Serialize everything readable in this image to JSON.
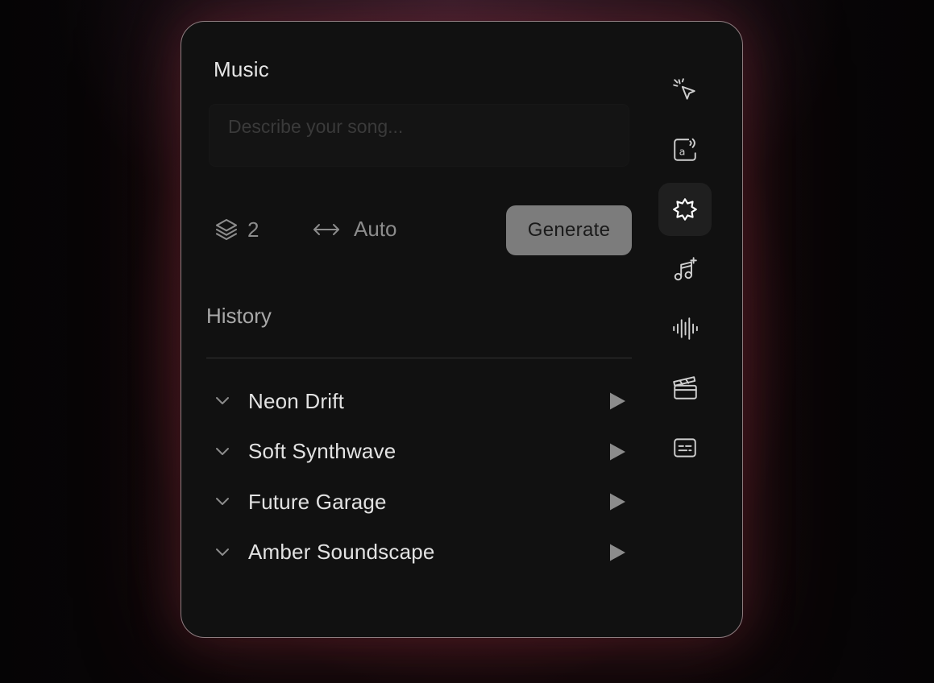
{
  "panel": {
    "title": "Music",
    "prompt_placeholder": "Describe your song...",
    "prompt_value": ""
  },
  "controls": {
    "variations_icon": "layers-icon",
    "variations_count": "2",
    "duration_icon": "arrows-horizontal-icon",
    "duration_label": "Auto",
    "generate_label": "Generate"
  },
  "history": {
    "title": "History",
    "items": [
      {
        "name": "Neon Drift"
      },
      {
        "name": "Soft Synthwave"
      },
      {
        "name": "Future Garage"
      },
      {
        "name": "Amber Soundscape"
      }
    ]
  },
  "rail": {
    "items": [
      {
        "icon": "cursor-sparkle-icon",
        "active": false
      },
      {
        "icon": "text-speech-icon",
        "active": false
      },
      {
        "icon": "starburst-icon",
        "active": true
      },
      {
        "icon": "music-note-sparkle-icon",
        "active": false
      },
      {
        "icon": "waveform-icon",
        "active": false
      },
      {
        "icon": "clapperboard-icon",
        "active": false
      },
      {
        "icon": "subtitles-icon",
        "active": false
      }
    ]
  },
  "colors": {
    "panel_bg": "#111111",
    "panel_border": "#8e7d80",
    "generate_bg": "#7c7c7c",
    "text_primary": "#e2e2e2",
    "text_muted": "#8c8c8c",
    "icon": "#cfcfcf",
    "active_bg": "#1f1f1f"
  }
}
